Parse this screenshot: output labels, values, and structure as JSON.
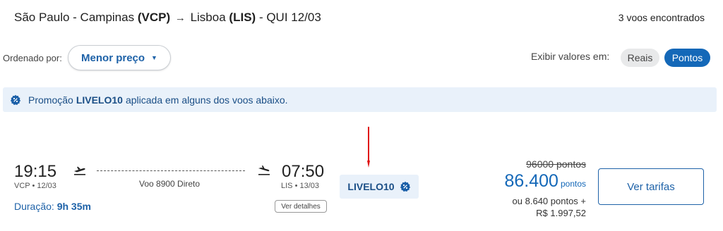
{
  "header": {
    "origin": "São Paulo - Campinas",
    "origin_code": "(VCP)",
    "destination": "Lisboa",
    "destination_code": "(LIS)",
    "date": "- QUI 12/03",
    "arrow": "→",
    "results_count": "3 voos encontrados"
  },
  "sort": {
    "label": "Ordenado por:",
    "selected": "Menor preço",
    "caret": "▼"
  },
  "display": {
    "label": "Exibir valores em:",
    "options": [
      "Reais",
      "Pontos"
    ],
    "selected": "Pontos"
  },
  "promo_banner": {
    "prefix": "Promoção",
    "code": "LIVELO10",
    "suffix": "aplicada em alguns dos voos abaixo.",
    "icon": "promo-badge-icon"
  },
  "annotation": {
    "red_arrow": "red-arrow-pointer"
  },
  "flight": {
    "departure_time": "19:15",
    "departure_place": "VCP • 12/03",
    "arrival_time": "07:50",
    "arrival_place": "LIS • 13/03",
    "flight_info": "Voo 8900 Direto",
    "duration_label": "Duração:",
    "duration_value": "9h 35m",
    "details_button": "Ver detalhes",
    "promo_tag": "LIVELO10",
    "price_old": "96000 pontos",
    "price_points": "86.400",
    "price_points_unit": "pontos",
    "price_alt_line1": "ou 8.640 pontos +",
    "price_alt_line2": "R$ 1.997,52",
    "cta": "Ver tarifas"
  },
  "colors": {
    "accent": "#1468b8",
    "promo_bg": "#e9f1fa",
    "promo_text": "#1a4e86",
    "annotation": "#e01010"
  }
}
